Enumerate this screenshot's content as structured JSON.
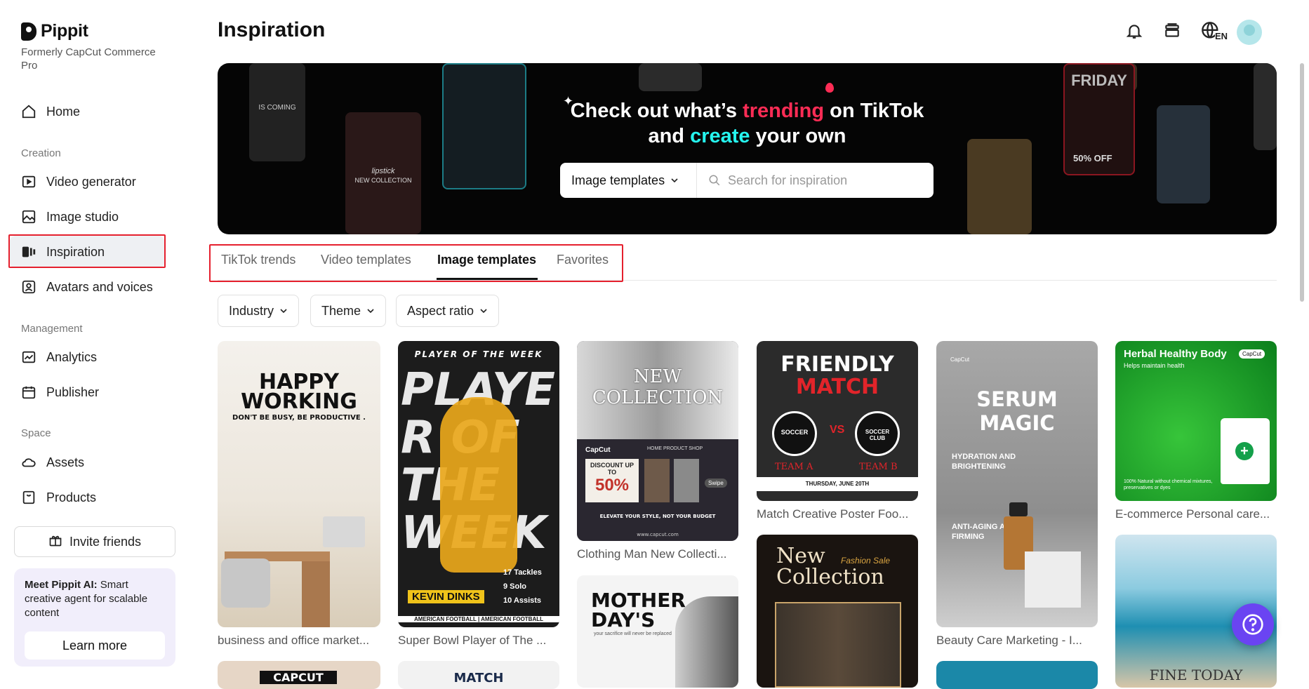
{
  "app": {
    "name": "Pippit",
    "subtitle": "Formerly CapCut Commerce Pro"
  },
  "sidebar": {
    "home": "Home",
    "sections": {
      "creation": "Creation",
      "management": "Management",
      "space": "Space"
    },
    "items": {
      "video_generator": "Video generator",
      "image_studio": "Image studio",
      "inspiration": "Inspiration",
      "avatars": "Avatars and voices",
      "analytics": "Analytics",
      "publisher": "Publisher",
      "assets": "Assets",
      "products": "Products"
    },
    "active_item": "inspiration",
    "invite_label": "Invite friends",
    "promo": {
      "bold": "Meet Pippit AI:",
      "text": " Smart creative agent for scalable content",
      "button": "Learn more"
    }
  },
  "header": {
    "title": "Inspiration",
    "language": "EN",
    "icons": [
      "bell-icon",
      "layers-icon",
      "globe-icon",
      "avatar"
    ]
  },
  "banner": {
    "line1_prefix": "Check out what’s ",
    "line1_highlight": "trending",
    "line1_suffix": " on TikTok",
    "line2_prefix": "and ",
    "line2_highlight": "create",
    "line2_suffix": " your own",
    "highlight_colors": {
      "trending": "#fe2c55",
      "create": "#25f4ee"
    },
    "search": {
      "selected": "Image templates",
      "placeholder": "Search for inspiration"
    },
    "deco_texts": {
      "coming": "IS COMING",
      "lipstick": "lipstick",
      "new_collection": "NEW COLLECTION",
      "friday": "FRIDAY",
      "off": "50% OFF"
    }
  },
  "tabs": [
    "TikTok trends",
    "Video templates",
    "Image templates",
    "Favorites"
  ],
  "active_tab": "Image templates",
  "filters": [
    "Industry",
    "Theme",
    "Aspect ratio"
  ],
  "cards": {
    "c1": {
      "caption": "business and office market...",
      "line1": "HAPPY",
      "line2": "WORKING",
      "line3": "DON'T BE BUSY, BE PRODUCTIVE ."
    },
    "c2": {
      "caption": "Super Bowl Player of The ...",
      "top": "PLAYER OF THE WEEK",
      "big": "PLAYER OF THE WEEK",
      "name": "KEVIN DINKS",
      "stats": [
        "17 Tackles",
        "9 Solo",
        "10 Assists"
      ],
      "footer": "AMERICAN FOOTBALL | AMERICAN FOOTBALL"
    },
    "c3": {
      "caption": "Clothing Man New Collecti...",
      "title": "NEW COLLECTION",
      "brand": "CapCut",
      "nav": "HOME  PRODUCT  SHOP",
      "discount": "DISCOUNT UP TO",
      "percent": "50%",
      "swipe": "Swipe",
      "tagline": "ELEVATE YOUR STYLE, NOT YOUR BUDGET",
      "url": "www.capcut.com"
    },
    "c4": {
      "caption": "Match Creative Poster Foo...",
      "line1": "FRIENDLY",
      "line2": "MATCH",
      "vs": "VS",
      "team_a": "TEAM A",
      "team_b": "TEAM B",
      "date": "THURSDAY, JUNE 20TH",
      "badge_a": "SOCCER",
      "badge_b": "SOCCER CLUB"
    },
    "c5": {
      "caption": "Beauty Care Marketing - I...",
      "title": "SERUM MAGIC",
      "brand": "CapCut",
      "h1": "HYDRATION AND BRIGHTENING",
      "h2": "ANTI-AGING AND FIRMING"
    },
    "c6": {
      "caption": "E-commerce Personal care...",
      "title": "Herbal Healthy Body",
      "sub": "Helps maintain health",
      "badge": "CapCut",
      "foot": "100% Natural without chemical mixtures, preservatives or dyes"
    },
    "c7": {
      "line1": "MOTHER",
      "line2": "DAY'S",
      "sub": "your sacrifice will never be replaced"
    },
    "c8": {
      "line1": "New",
      "line2": "Collection",
      "script": "Fashion Sale"
    },
    "c9": {
      "text": "FINE TODAY"
    },
    "c10": {
      "text": "CAPCUT"
    },
    "c11": {
      "text": "MATCH"
    }
  }
}
